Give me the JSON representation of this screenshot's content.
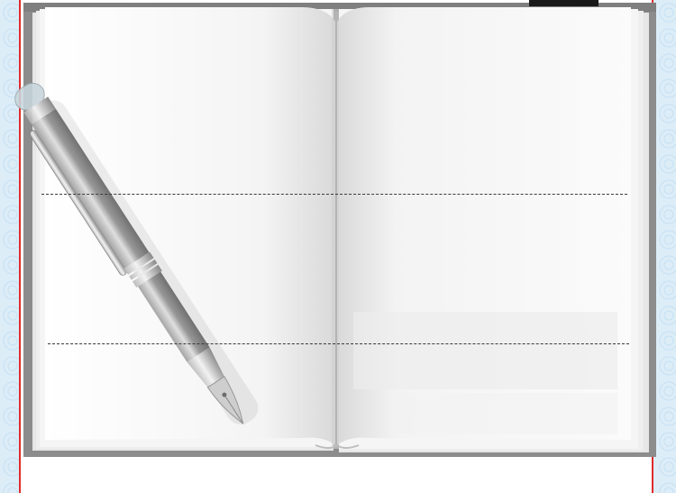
{
  "colors": {
    "background": "#dcedf8",
    "panel": "#ffffff",
    "panel_border": "#e02b2b",
    "book_cover": "#8c8c8c",
    "page": "#f3f3f3",
    "bookmark": "#1a1a1a",
    "dashed_line": "#3a3a3a"
  },
  "icons": {
    "pen": "fountain-pen-icon",
    "bookmark": "bookmark-ribbon-icon"
  }
}
